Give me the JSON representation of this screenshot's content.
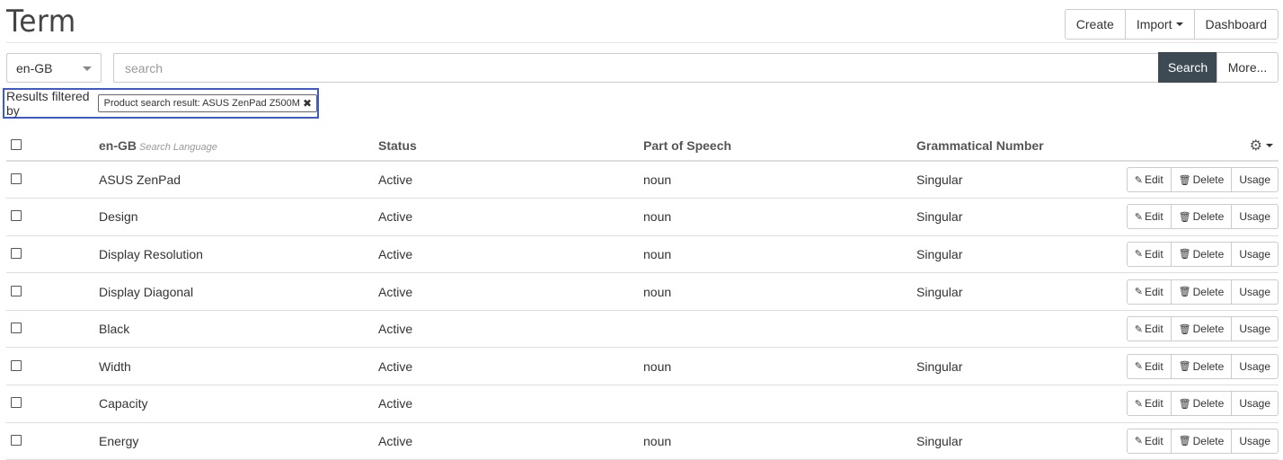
{
  "header": {
    "title": "Term",
    "buttons": {
      "create": "Create",
      "import": "Import",
      "dashboard": "Dashboard"
    }
  },
  "search": {
    "language": "en-GB",
    "placeholder": "search",
    "value": "",
    "search_label": "Search",
    "more_label": "More..."
  },
  "filter": {
    "label": "Results filtered by",
    "tag": "Product search result: ASUS ZenPad Z500M",
    "remove_icon": "close-icon"
  },
  "table": {
    "columns": {
      "term": "en-GB",
      "term_sub": "Search Language",
      "status": "Status",
      "pos": "Part of Speech",
      "number": "Grammatical Number"
    },
    "actions": {
      "edit": "Edit",
      "delete": "Delete",
      "usage": "Usage"
    },
    "rows": [
      {
        "term": "ASUS ZenPad",
        "status": "Active",
        "pos": "noun",
        "number": "Singular"
      },
      {
        "term": "Design",
        "status": "Active",
        "pos": "noun",
        "number": "Singular"
      },
      {
        "term": "Display Resolution",
        "status": "Active",
        "pos": "noun",
        "number": "Singular"
      },
      {
        "term": "Display Diagonal",
        "status": "Active",
        "pos": "noun",
        "number": "Singular"
      },
      {
        "term": "Black",
        "status": "Active",
        "pos": "",
        "number": ""
      },
      {
        "term": "Width",
        "status": "Active",
        "pos": "noun",
        "number": "Singular"
      },
      {
        "term": "Capacity",
        "status": "Active",
        "pos": "",
        "number": ""
      },
      {
        "term": "Energy",
        "status": "Active",
        "pos": "noun",
        "number": "Singular"
      }
    ]
  },
  "colors": {
    "search_button": "#3e4a53",
    "filter_outline": "#3d5ad6"
  }
}
